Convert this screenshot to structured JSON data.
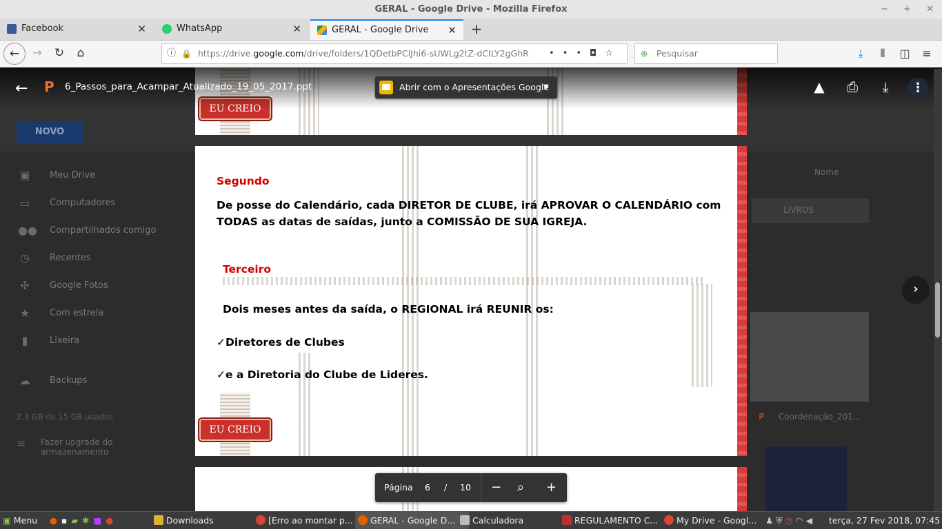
{
  "window": {
    "title": "GERAL - Google Drive - Mozilla Firefox",
    "controls": [
      "−",
      "+",
      "✕"
    ]
  },
  "tabs": [
    {
      "label": "Facebook",
      "fav_color": "#3b5998",
      "active": false
    },
    {
      "label": "WhatsApp",
      "fav_color": "#25d366",
      "active": false
    },
    {
      "label": "GERAL - Google Drive",
      "fav_color": "#f4b400",
      "active": true
    }
  ],
  "navbar": {
    "url_prefix": "https://drive.",
    "url_domain": "google.com",
    "url_path": "/drive/folders/1QDetbPClJhi6-sUWLg2tZ-dCILY2gGhR",
    "search_placeholder": "Pesquisar"
  },
  "drive": {
    "new_button": "NOVO",
    "sidebar": [
      {
        "icon": "drive-icon",
        "glyph": "▣",
        "label": "Meu Drive"
      },
      {
        "icon": "computer-icon",
        "glyph": "▭",
        "label": "Computadores"
      },
      {
        "icon": "people-icon",
        "glyph": "👥",
        "label": "Compartilhados comigo"
      },
      {
        "icon": "clock-icon",
        "glyph": "◷",
        "label": "Recentes"
      },
      {
        "icon": "pinwheel-icon",
        "glyph": "✣",
        "label": "Google Fotos"
      },
      {
        "icon": "star-icon",
        "glyph": "★",
        "label": "Com estrela"
      },
      {
        "icon": "trash-icon",
        "glyph": "🗑",
        "label": "Lixeira"
      },
      {
        "icon": "cloud-icon",
        "glyph": "☁",
        "label": "Backups"
      }
    ],
    "usage": "2,3 GB de 15 GB usados",
    "upgrade": "Fazer upgrade do armazenamento",
    "sort_label": "Nome",
    "folder_label": "LIVROS",
    "file_label": "Coordenação_201..."
  },
  "viewer": {
    "file_name": "6_Passos_para_Acampar_Atualizado_19_05_2017.ppt",
    "open_with": "Abrir com o Apresentações Google",
    "page_label": "Página",
    "page_current": "6",
    "page_sep": "/",
    "page_total": "10"
  },
  "slide": {
    "badge": "EU CREIO",
    "heading1": "Segundo",
    "para1_line1": "De posse do Calendário, cada DIRETOR DE CLUBE, irá APROVAR O CALENDÁRIO com",
    "para1_line2": "TODAS as datas de saídas, junto a COMISSÃO DE SUA IGREJA.",
    "heading2": "Terceiro",
    "para2": "Dois meses antes da saída, o REGIONAL irá REUNIR os:",
    "bullet1": "✓Diretores de Clubes",
    "bullet2": "✓e a Diretoria do Clube de Lideres."
  },
  "taskbar": {
    "menu": "Menu",
    "items": [
      {
        "label": "Downloads",
        "color": "#e0b030",
        "active": false
      },
      {
        "label": "[Erro ao montar p...",
        "color": "#db4437",
        "active": false
      },
      {
        "label": "GERAL - Google D...",
        "color": "#e66000",
        "active": true
      },
      {
        "label": "Calculadora",
        "color": "#bbbbbb",
        "active": false
      },
      {
        "label": "REGULAMENTO C...",
        "color": "#c03030",
        "active": false
      },
      {
        "label": "My Drive - Googl...",
        "color": "#db4437",
        "active": false
      }
    ],
    "clock": "terça, 27 Fev 2018, 07:45"
  },
  "colors": {
    "accent_red": "#d40000",
    "firefox_blue": "#0a84ff",
    "slides_yellow": "#f4b400"
  }
}
